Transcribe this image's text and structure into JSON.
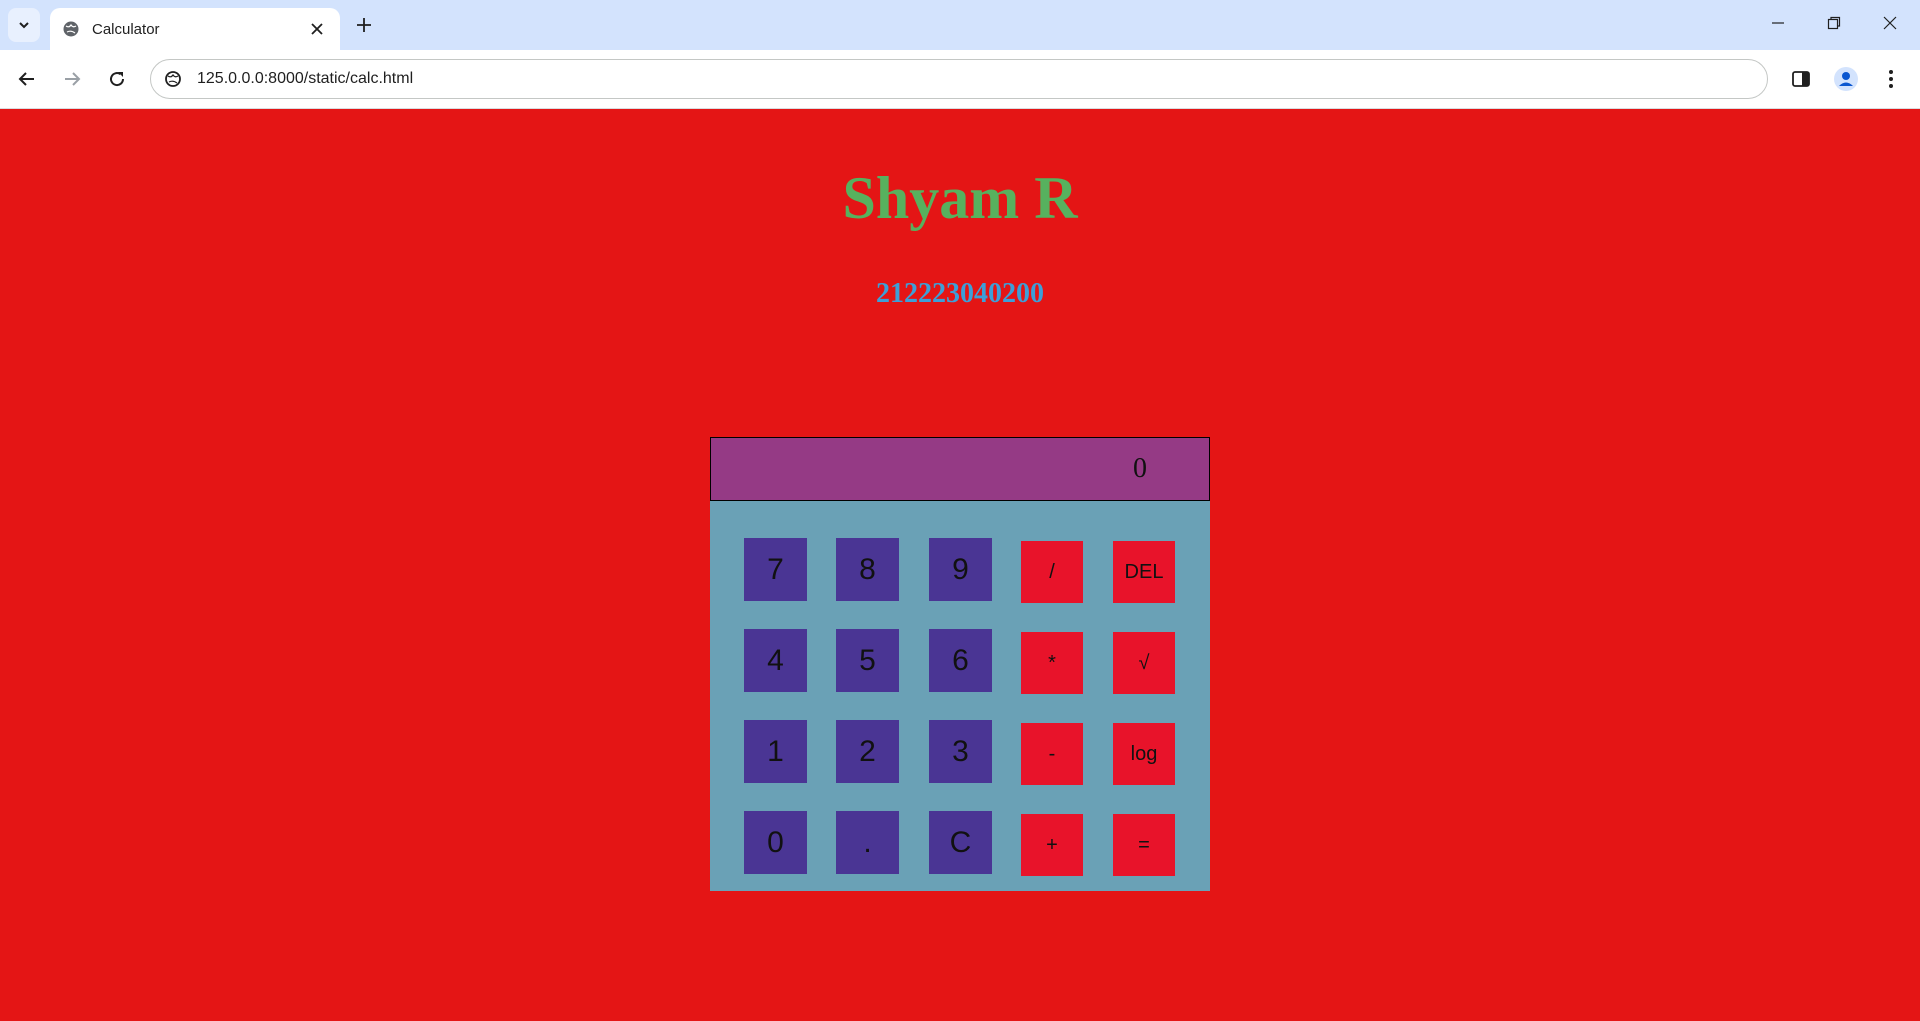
{
  "browser": {
    "tab_title": "Calculator",
    "url": "125.0.0.0:8000/static/calc.html",
    "icons": {
      "tab_search": "chevron-down-icon",
      "favicon": "globe-icon",
      "tab_close": "close-icon",
      "new_tab": "plus-icon",
      "back": "arrow-left-icon",
      "forward": "arrow-right-icon",
      "reload": "reload-icon",
      "site_info": "site-info-icon",
      "side_panel": "side-panel-icon",
      "profile": "profile-icon",
      "menu": "kebab-menu-icon",
      "minimize": "minimize-icon",
      "restore": "restore-icon",
      "close_window": "close-icon"
    }
  },
  "page": {
    "title": "Shyam R",
    "subtitle": "212223040200",
    "colors": {
      "background": "#e41515",
      "title": "#57b15e",
      "subtitle": "#3d9fd8",
      "calc_body": "#6aa1b6",
      "display": "#953a85",
      "number_key": "#4a3594",
      "operator_key": "#e8132a"
    }
  },
  "calculator": {
    "display_value": "0",
    "keys": [
      [
        "7",
        "8",
        "9",
        "/",
        "DEL"
      ],
      [
        "4",
        "5",
        "6",
        "*",
        "√"
      ],
      [
        "1",
        "2",
        "3",
        "-",
        "log"
      ],
      [
        "0",
        ".",
        "C",
        "+",
        "="
      ]
    ]
  }
}
